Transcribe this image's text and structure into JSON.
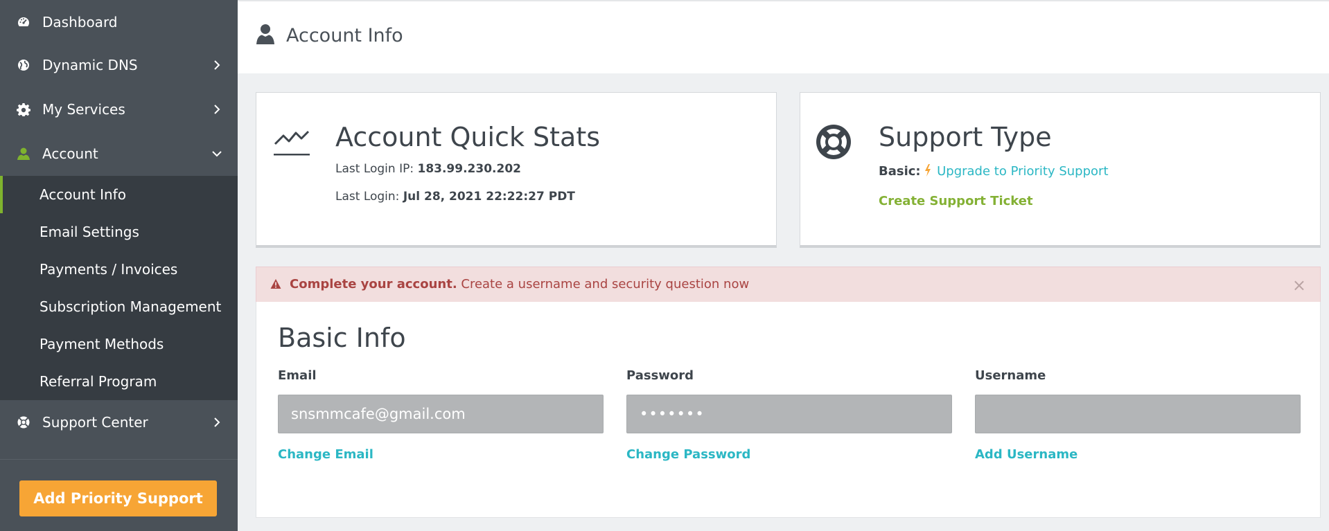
{
  "sidebar": {
    "items": [
      {
        "label": "Dashboard",
        "icon": "dashboard-icon"
      },
      {
        "label": "Dynamic DNS",
        "icon": "globe-icon"
      },
      {
        "label": "My Services",
        "icon": "gear-icon"
      },
      {
        "label": "Account",
        "icon": "user-icon"
      },
      {
        "label": "Support Center",
        "icon": "lifebuoy-icon"
      }
    ],
    "account_submenu": [
      "Account Info",
      "Email Settings",
      "Payments / Invoices",
      "Subscription Management",
      "Payment Methods",
      "Referral Program"
    ],
    "priority_button": "Add Priority Support"
  },
  "header": {
    "title": "Account Info"
  },
  "quick_stats": {
    "title": "Account Quick Stats",
    "last_ip_label": "Last Login IP: ",
    "last_ip_value": "183.99.230.202",
    "last_login_label": "Last Login: ",
    "last_login_value": "Jul 28, 2021 22:22:27 PDT"
  },
  "support_type": {
    "title": "Support Type",
    "basic_label": "Basic:",
    "upgrade_link": "Upgrade to Priority Support",
    "ticket_link": "Create Support Ticket"
  },
  "alert": {
    "strong": "Complete your account.",
    "text": " Create a username and security question now",
    "close": "×"
  },
  "basic_info": {
    "title": "Basic Info",
    "fields": [
      {
        "label": "Email",
        "value": "snsmmcafe@gmail.com",
        "link": "Change Email"
      },
      {
        "label": "Password",
        "value": "•••••••",
        "link": "Change Password"
      },
      {
        "label": "Username",
        "value": "",
        "link": "Add Username"
      }
    ]
  },
  "colors": {
    "sidebar_bg": "#4a5158",
    "submenu_bg": "#363c42",
    "accent_green": "#7fb32e",
    "link_blue": "#2bb7c4",
    "priority_orange": "#f7a535",
    "alert_bg": "#f2dede",
    "alert_text": "#a94442"
  }
}
